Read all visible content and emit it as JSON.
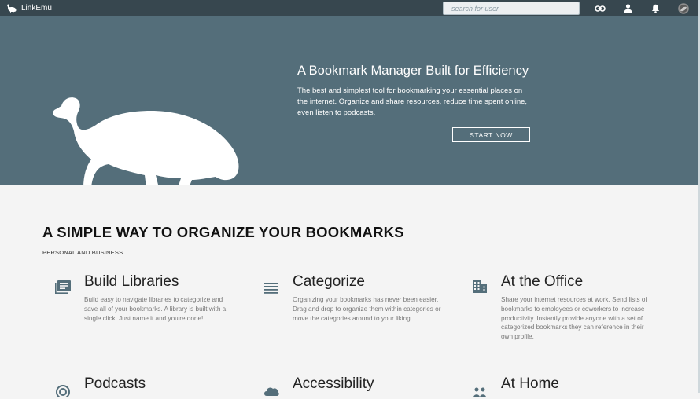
{
  "app": {
    "brand": "LinkEmu"
  },
  "header": {
    "search_placeholder": "search for user",
    "icons": [
      "link-icon",
      "user-icon",
      "bell-icon",
      "avatar"
    ]
  },
  "hero": {
    "title": "A Bookmark Manager Built for Efficiency",
    "text": "The best and simplest tool for bookmarking your essential places on the internet. Organize and share resources, reduce time spent online, even listen to podcasts.",
    "cta": "START NOW"
  },
  "section": {
    "title": "A SIMPLE WAY TO ORGANIZE YOUR BOOKMARKS",
    "subtitle": "PERSONAL AND BUSINESS"
  },
  "features": [
    {
      "title": "Build Libraries",
      "text": "Build easy to navigate libraries to categorize and save all of your bookmarks. A library is built with a single click. Just name it and you're done!",
      "icon": "library-icon"
    },
    {
      "title": "Categorize",
      "text": "Organizing your bookmarks has never been easier. Drag and drop to organize them within categories or move the categories around to your liking.",
      "icon": "list-icon"
    },
    {
      "title": "At the Office",
      "text": "Share your internet resources at work. Send lists of bookmarks to employees or coworkers to increase productivity. Instantly provide anyone with a set of categorized bookmarks they can reference in their own profile.",
      "icon": "office-icon"
    },
    {
      "title": "Podcasts",
      "text": "",
      "icon": "podcast-icon"
    },
    {
      "title": "Accessibility",
      "text": "",
      "icon": "cloud-icon"
    },
    {
      "title": "At Home",
      "text": "",
      "icon": "people-icon"
    }
  ],
  "colors": {
    "topbar": "#37474f",
    "hero": "#546e7a",
    "background": "#f4f4f4"
  }
}
